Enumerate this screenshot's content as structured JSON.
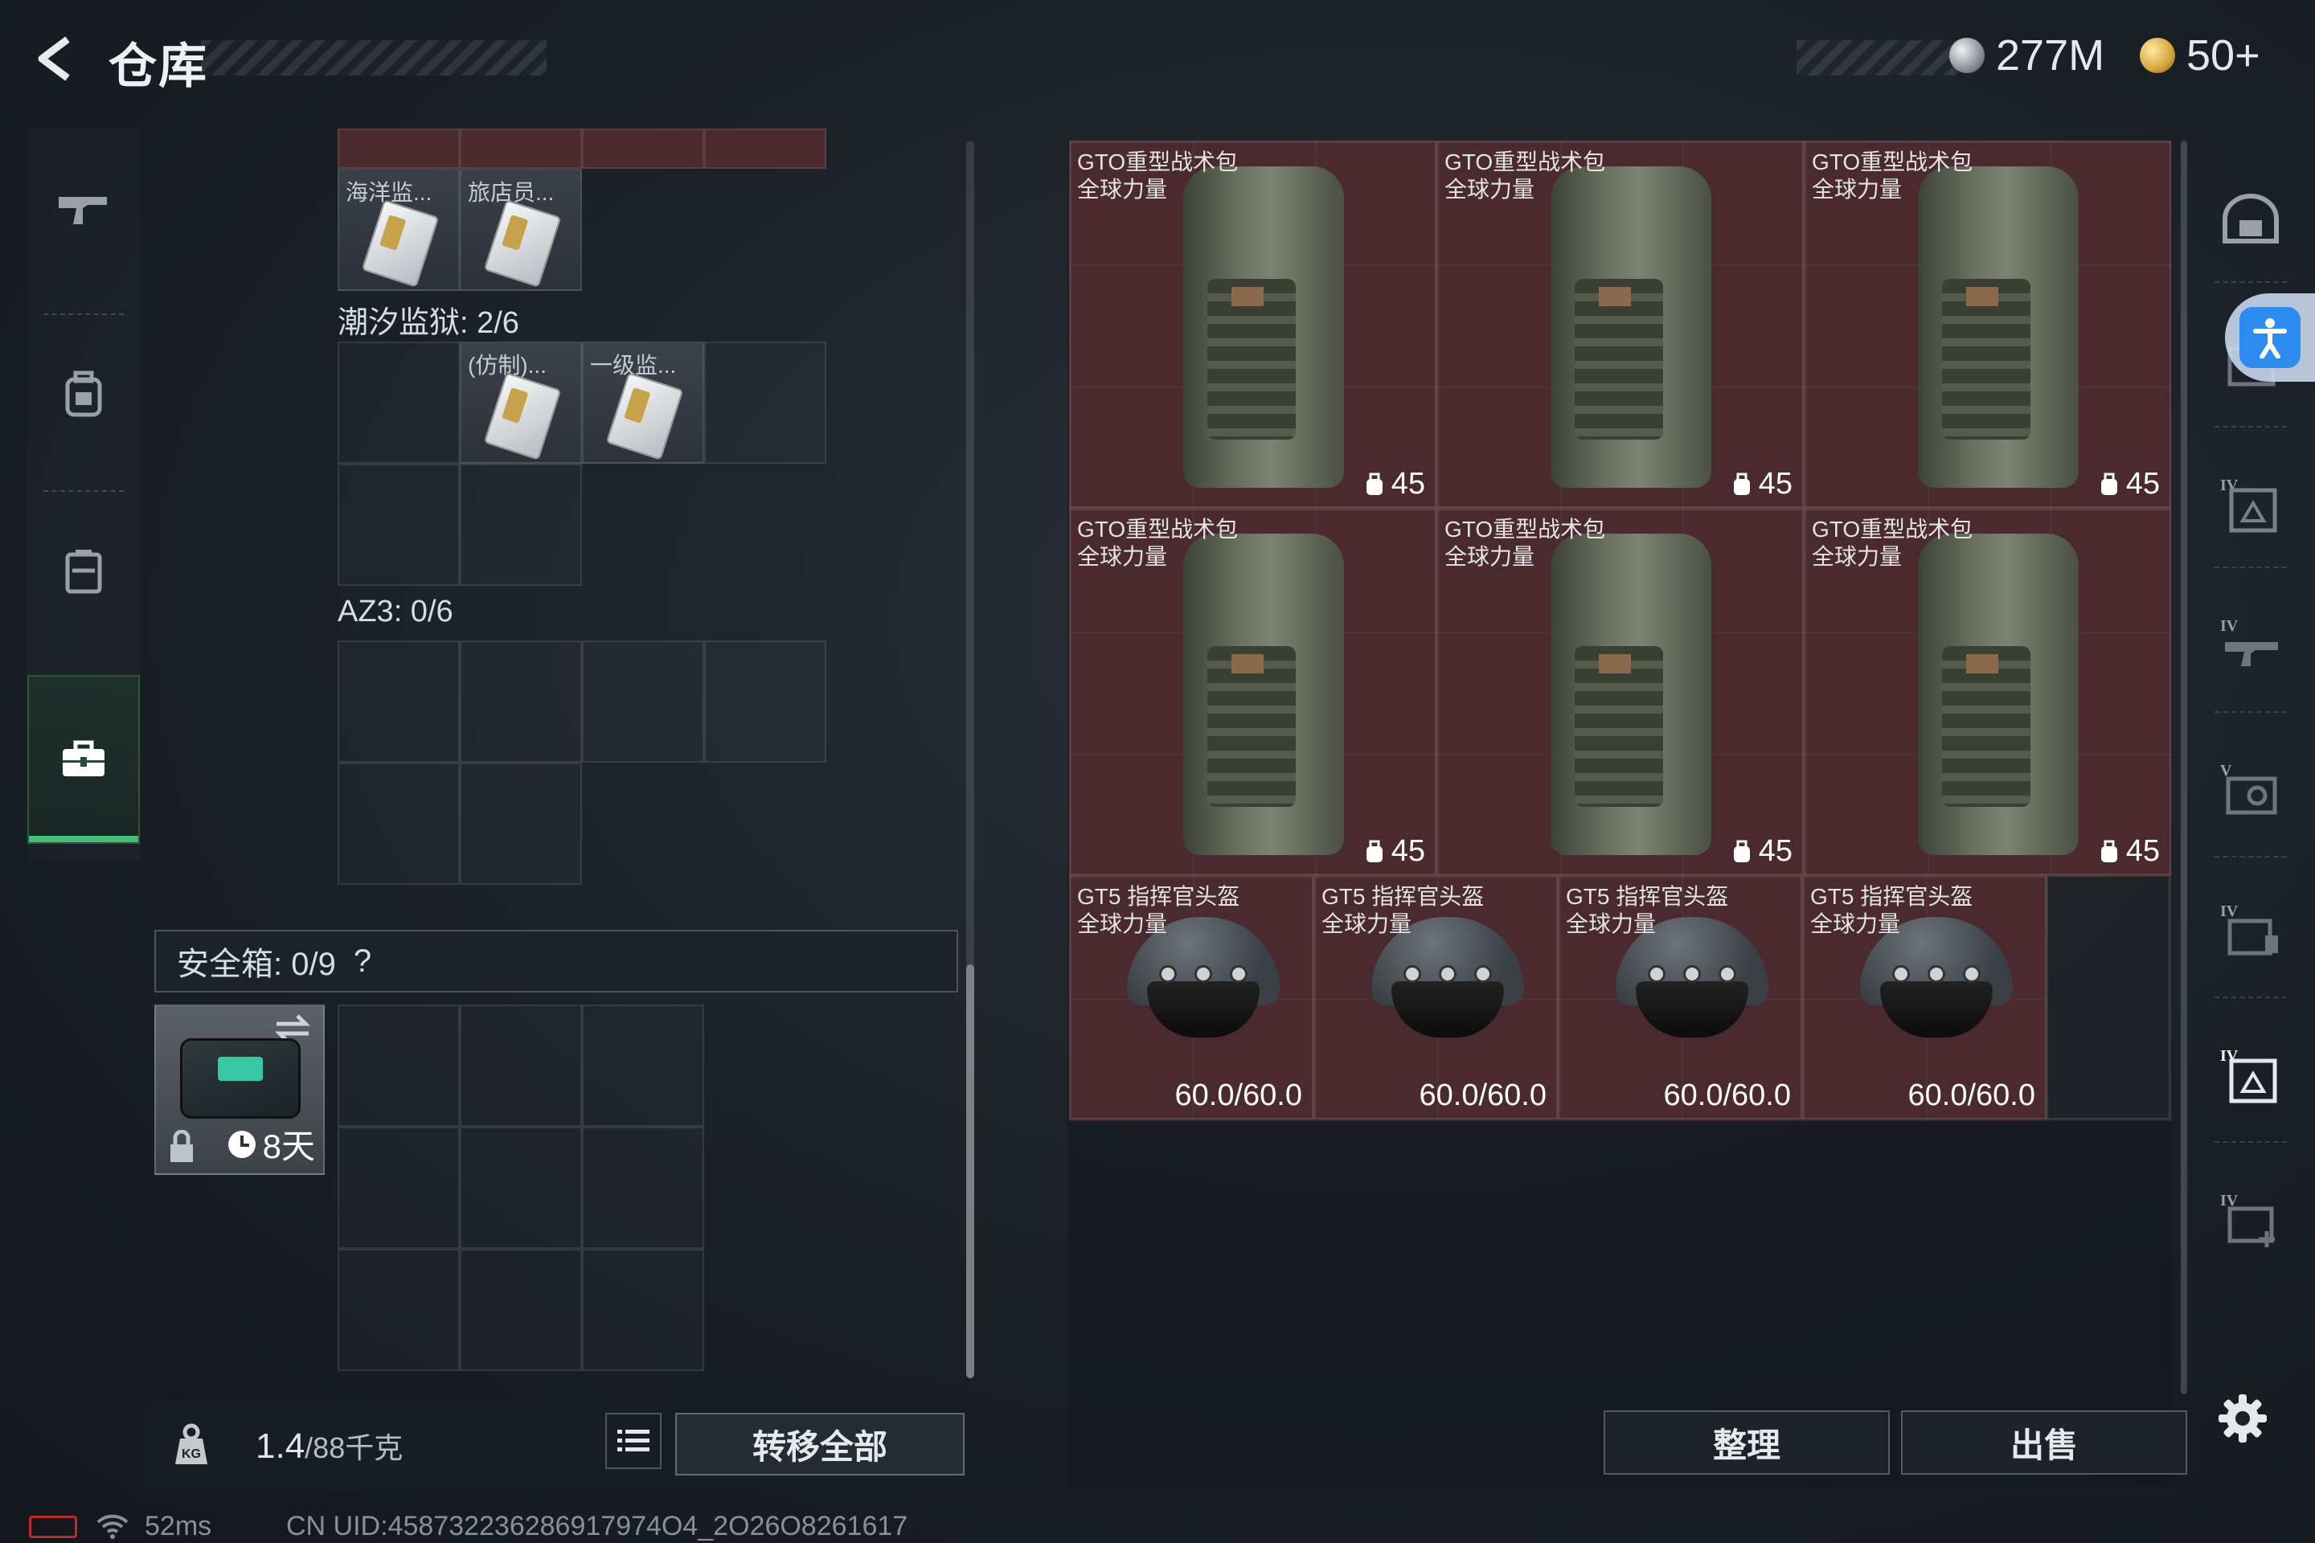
{
  "header": {
    "title": "仓库",
    "currency_silver": "277M",
    "currency_gold": "50+"
  },
  "left_panel": {
    "top_row_labels": [
      "海洋监...",
      "旅店员..."
    ],
    "tidal_prison_label": "潮汐监狱: 2/6",
    "tidal_items": [
      "(仿制)...",
      "一级监..."
    ],
    "az3_label": "AZ3: 0/6",
    "safebox_label": "安全箱: 0/9",
    "safebox_help": "?",
    "safebox_days": "8天",
    "weight_value": "1.4",
    "weight_capacity": "/88千克",
    "transfer_all": "转移全部"
  },
  "right_panel": {
    "backpacks": [
      {
        "name": "GTO重型战术包",
        "sub": "全球力量",
        "value": "45"
      },
      {
        "name": "GTO重型战术包",
        "sub": "全球力量",
        "value": "45"
      },
      {
        "name": "GTO重型战术包",
        "sub": "全球力量",
        "value": "45"
      },
      {
        "name": "GTO重型战术包",
        "sub": "全球力量",
        "value": "45"
      },
      {
        "name": "GTO重型战术包",
        "sub": "全球力量",
        "value": "45"
      },
      {
        "name": "GTO重型战术包",
        "sub": "全球力量",
        "value": "45"
      }
    ],
    "helmets": [
      {
        "name": "GT5 指挥官头盔",
        "sub": "全球力量",
        "durability": "60.0/60.0"
      },
      {
        "name": "GT5 指挥官头盔",
        "sub": "全球力量",
        "durability": "60.0/60.0"
      },
      {
        "name": "GT5 指挥官头盔",
        "sub": "全球力量",
        "durability": "60.0/60.0"
      },
      {
        "name": "GT5 指挥官头盔",
        "sub": "全球力量",
        "durability": "60.0/60.0"
      }
    ],
    "sort_label": "整理",
    "sell_label": "出售"
  },
  "status": {
    "ping": "52ms",
    "uid": "CN UID:458732236286917974O4_2O26O8261617"
  },
  "colors": {
    "accent_green": "#3fbf7a",
    "item_bg": "#4a2a2e",
    "access_blue": "#2d8cf0"
  }
}
